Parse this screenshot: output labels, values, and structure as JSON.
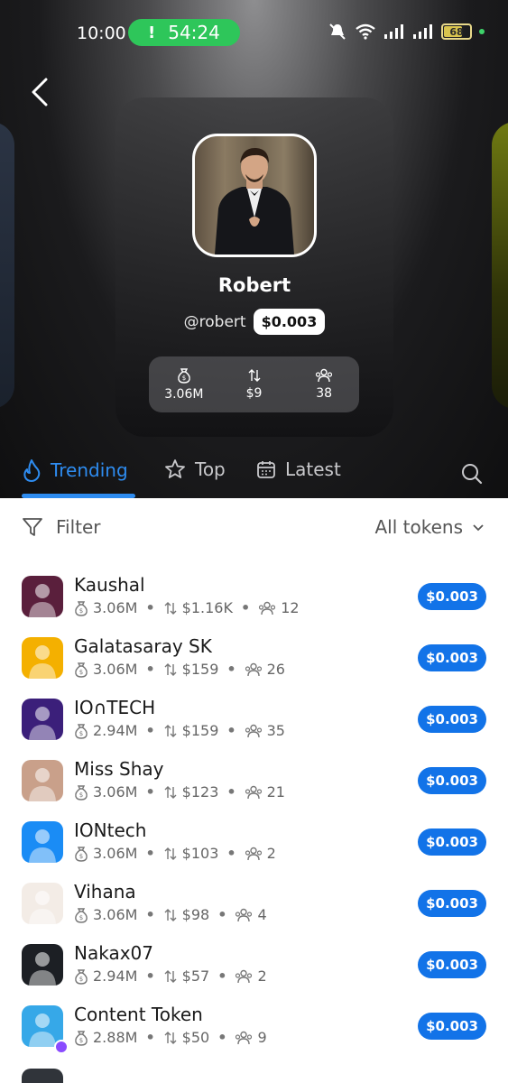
{
  "status_bar": {
    "time": "10:00",
    "timer": "54:24",
    "battery": "68"
  },
  "profile": {
    "name": "Robert",
    "handle": "@robert",
    "price": "$0.003",
    "stats": [
      {
        "icon": "money-bag-icon",
        "value": "3.06M"
      },
      {
        "icon": "swap-arrows-icon",
        "value": "$9"
      },
      {
        "icon": "holders-icon",
        "value": "38"
      }
    ]
  },
  "tabs": [
    {
      "label": "Trending",
      "icon": "flame-icon",
      "active": true
    },
    {
      "label": "Top",
      "icon": "star-icon",
      "active": false
    },
    {
      "label": "Latest",
      "icon": "calendar-icon",
      "active": false
    }
  ],
  "filter": {
    "label": "Filter",
    "dropdown": "All tokens"
  },
  "tokens": [
    {
      "name": "Kaushal",
      "mcap": "3.06M",
      "volume": "$1.16K",
      "holders": "12",
      "price": "$0.003",
      "color": "#5a1f3c"
    },
    {
      "name": "Galatasaray SK",
      "mcap": "3.06M",
      "volume": "$159",
      "holders": "26",
      "price": "$0.003",
      "color": "#f4b000"
    },
    {
      "name": "IO∩TECH",
      "mcap": "2.94M",
      "volume": "$159",
      "holders": "35",
      "price": "$0.003",
      "color": "#3b1f7a"
    },
    {
      "name": "Miss Shay",
      "mcap": "3.06M",
      "volume": "$123",
      "holders": "21",
      "price": "$0.003",
      "color": "#c9a08a"
    },
    {
      "name": "IONtech",
      "mcap": "3.06M",
      "volume": "$103",
      "holders": "2",
      "price": "$0.003",
      "color": "#1a8cf5"
    },
    {
      "name": "Vihana",
      "mcap": "3.06M",
      "volume": "$98",
      "holders": "4",
      "price": "$0.003",
      "color": "#f3ece6"
    },
    {
      "name": "Nakax07",
      "mcap": "2.94M",
      "volume": "$57",
      "holders": "2",
      "price": "$0.003",
      "color": "#1c1f24"
    },
    {
      "name": "Content Token",
      "mcap": "2.88M",
      "volume": "$50",
      "holders": "9",
      "price": "$0.003",
      "color": "#36a8e8"
    }
  ]
}
